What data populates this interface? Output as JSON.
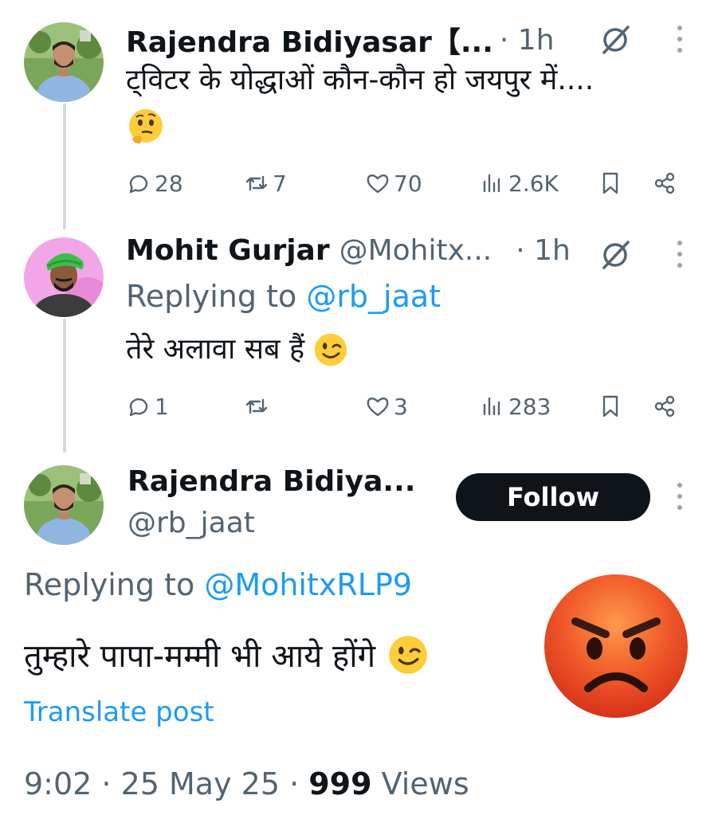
{
  "tweet1": {
    "name": "Rajendra Bidiyasar【...",
    "time": "· 1h",
    "text": "ट्विटर के योद्धाओं कौन-कौन हो जयपुर में....",
    "emoji": "thinking-face",
    "stats": {
      "replies": "28",
      "reposts": "7",
      "likes": "70",
      "views": "2.6K"
    }
  },
  "tweet2": {
    "name": "Mohit Gurjar",
    "handle": "@Mohitx...",
    "time": "· 1h",
    "replying_prefix": "Replying to ",
    "replying_handle": "@rb_jaat",
    "text": "तेरे अलावा सब हैं",
    "emoji": "winking-face",
    "stats": {
      "replies": "1",
      "reposts": "",
      "likes": "3",
      "views": "283"
    }
  },
  "main": {
    "name": "Rajendra Bidiya...",
    "handle": "@rb_jaat",
    "follow_label": "Follow",
    "replying_prefix": "Replying to ",
    "replying_handle": "@MohitxRLP9",
    "text": "तुम्हारे पापा-मम्मी भी आये होंगे",
    "emoji": "winking-face",
    "translate_label": "Translate post",
    "time": "9:02 · 25 May 25 · ",
    "views_count": "999",
    "views_label": " Views",
    "overlay_emoji": "angry-face"
  },
  "colors": {
    "link": "#1d9bf0",
    "secondary_text": "#536471",
    "primary_text": "#0f1419",
    "follow_bg": "#0f1419"
  }
}
